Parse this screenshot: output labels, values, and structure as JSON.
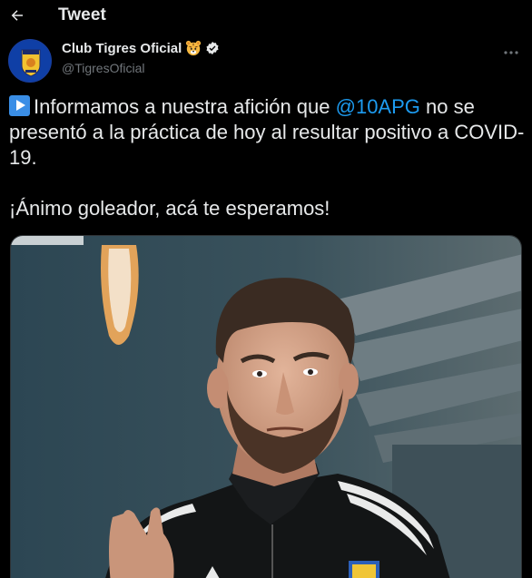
{
  "topbar": {
    "title": "Tweet",
    "back_icon": "arrow-left-icon"
  },
  "tweet": {
    "author": {
      "display_name": "Club Tigres Oficial",
      "handle": "@TigresOficial",
      "avatar_icon": "tigres-crest-logo",
      "name_emoji": "tiger-face-icon",
      "verified_icon": "verified-badge-icon"
    },
    "more_icon": "more-horizontal-icon",
    "body": {
      "lead_icon": "play-button-emoji",
      "text_part1": "Informamos a nuestra afición que ",
      "mention": "@10APG",
      "text_part2": " no se presentó a la práctica de hoy al resultar positivo a COVID-19.",
      "line2": "¡Ánimo goleador, acá te esperamos!"
    },
    "media": {
      "type": "photo",
      "subject": "player-photo"
    }
  },
  "colors": {
    "background": "#000000",
    "text": "#e7e9ea",
    "secondary_text": "#71767b",
    "accent": "#1d9bf0"
  }
}
